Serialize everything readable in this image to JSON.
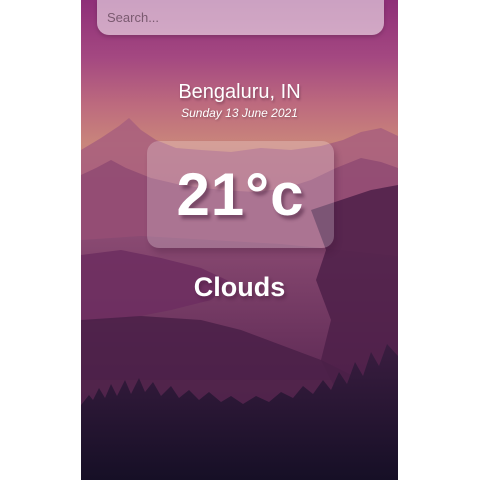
{
  "search": {
    "placeholder": "Search..."
  },
  "location": {
    "city": "Bengaluru, IN",
    "date": "Sunday 13 June 2021"
  },
  "weather": {
    "temperature": "21°c",
    "condition": "Clouds"
  },
  "colors": {
    "sky_top": "#9b3b7f",
    "sky_mid": "#c06a7c",
    "horizon": "#c8827a",
    "mountain_far": "#a8607c",
    "mountain_mid": "#7e3a66",
    "mountain_near": "#52234c",
    "forest": "#1e1530"
  }
}
